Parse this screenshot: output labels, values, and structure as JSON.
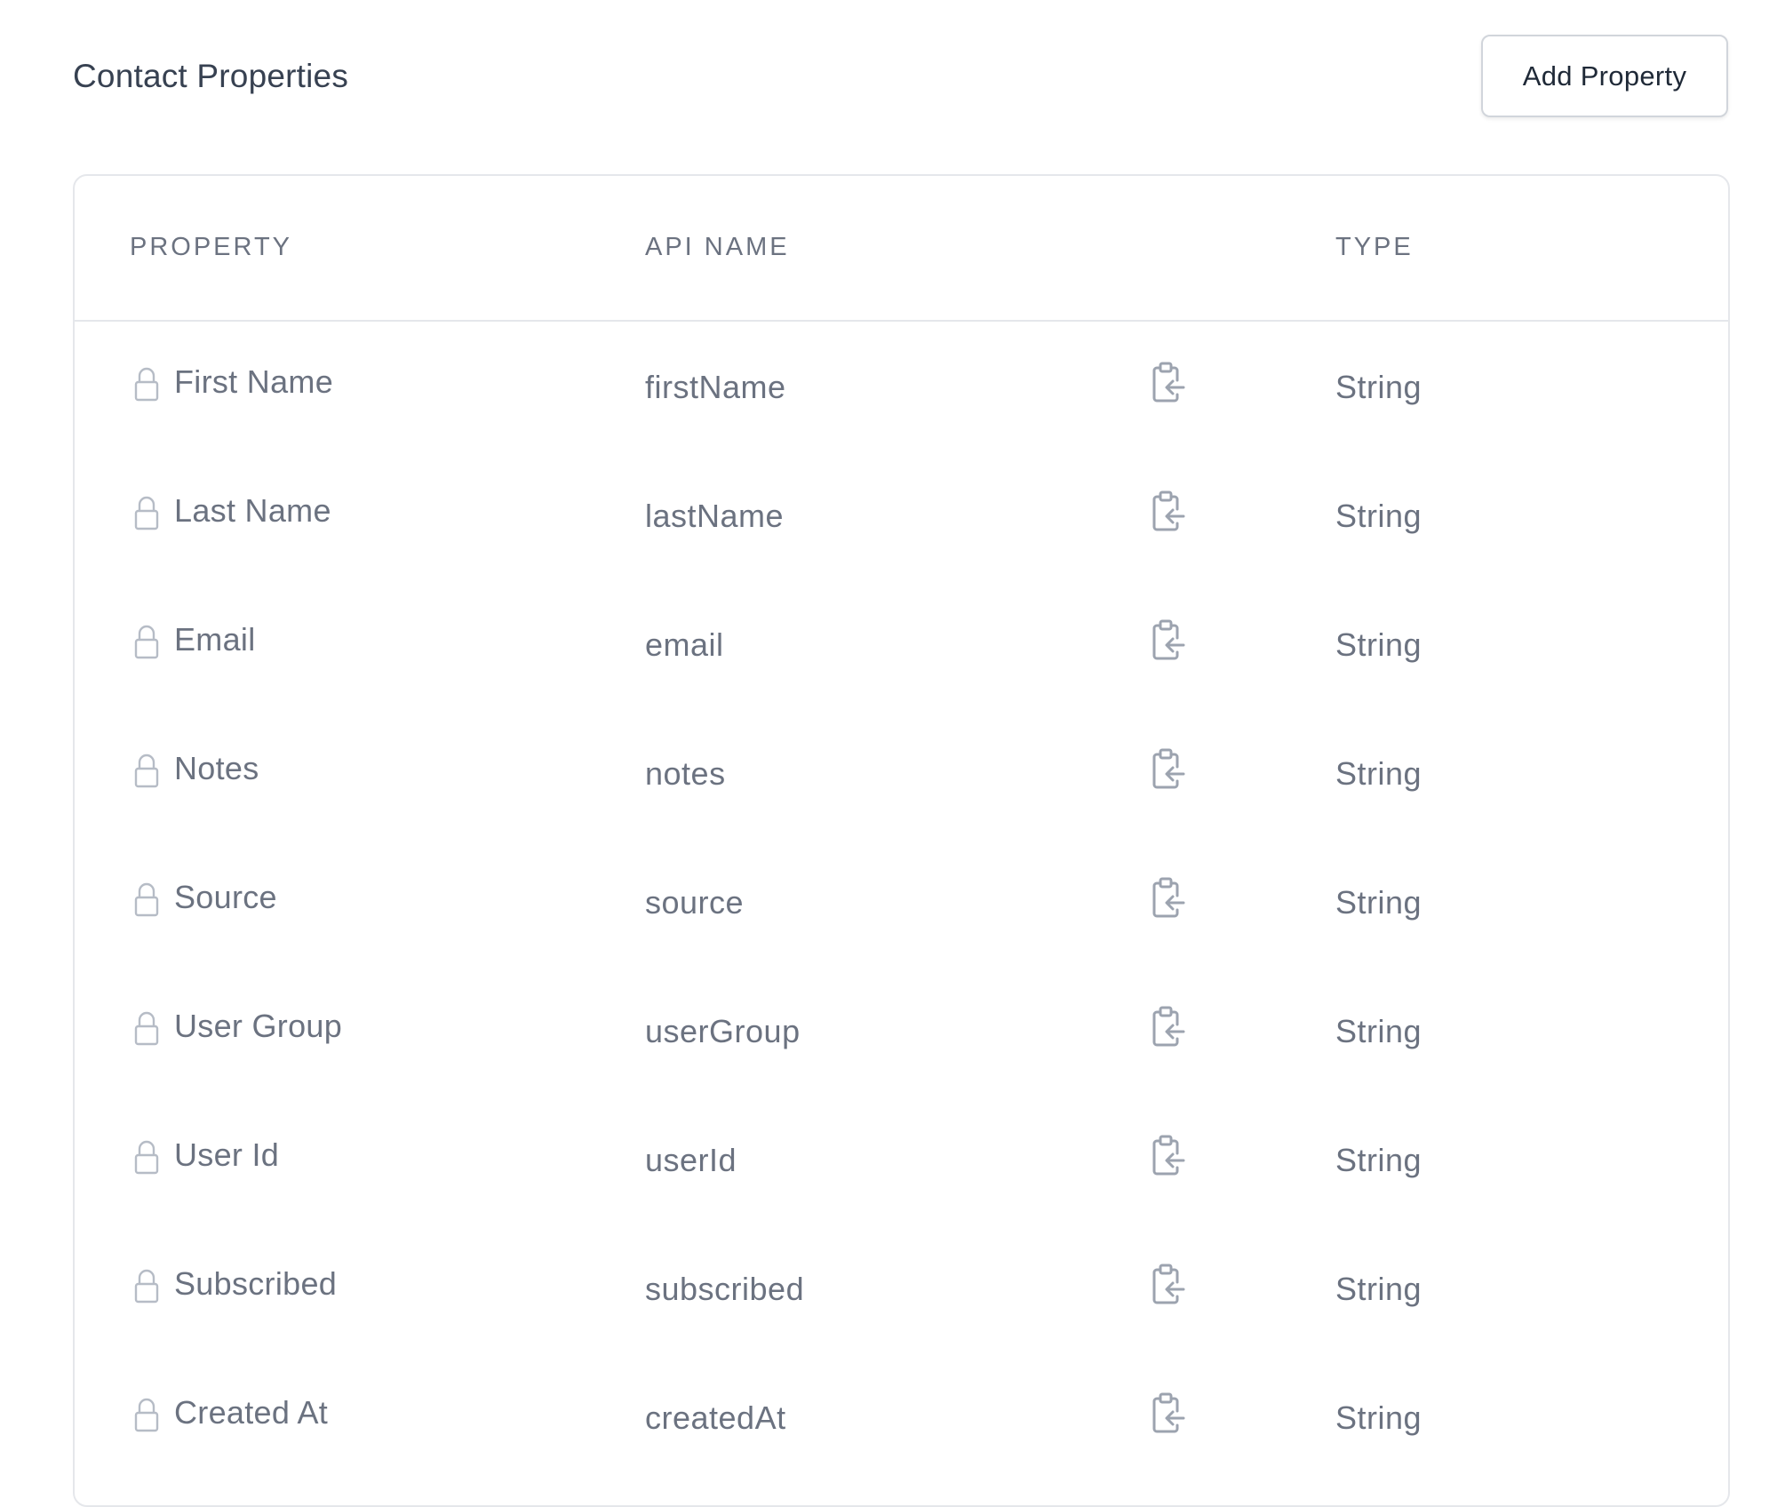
{
  "header": {
    "title": "Contact Properties",
    "add_button_label": "Add Property"
  },
  "table": {
    "columns": {
      "property": "PROPERTY",
      "api_name": "API NAME",
      "type": "TYPE"
    },
    "rows": [
      {
        "property": "First Name",
        "api_name": "firstName",
        "type": "String",
        "icon": "lock-icon"
      },
      {
        "property": "Last Name",
        "api_name": "lastName",
        "type": "String",
        "icon": "lock-icon"
      },
      {
        "property": "Email",
        "api_name": "email",
        "type": "String",
        "icon": "lock-icon"
      },
      {
        "property": "Notes",
        "api_name": "notes",
        "type": "String",
        "icon": "lock-icon"
      },
      {
        "property": "Source",
        "api_name": "source",
        "type": "String",
        "icon": "lock-icon"
      },
      {
        "property": "User Group",
        "api_name": "userGroup",
        "type": "String",
        "icon": "lock-icon"
      },
      {
        "property": "User Id",
        "api_name": "userId",
        "type": "String",
        "icon": "lock-icon"
      },
      {
        "property": "Subscribed",
        "api_name": "subscribed",
        "type": "String",
        "icon": "lock-icon"
      },
      {
        "property": "Created At",
        "api_name": "createdAt",
        "type": "String",
        "icon": "lock-icon"
      }
    ]
  },
  "colors": {
    "border": "#e5e7eb",
    "text_muted": "#6b7280",
    "text_dark": "#374151",
    "icon": "#9ca3af"
  }
}
